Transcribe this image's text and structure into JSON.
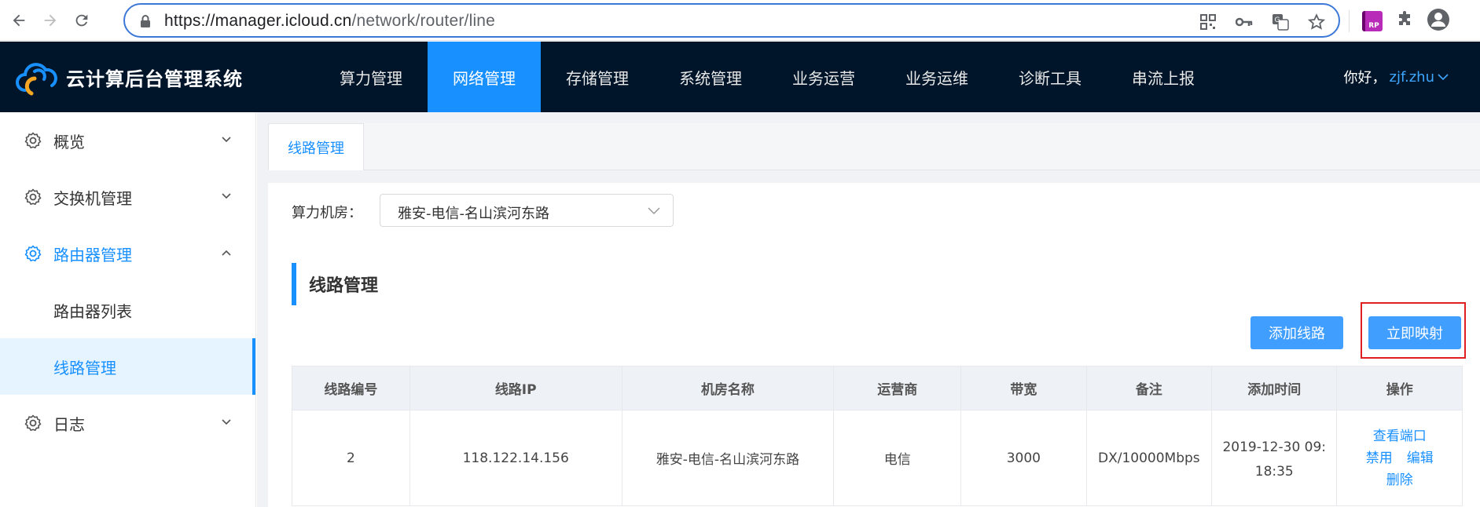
{
  "browser": {
    "url_host": "https://manager.icloud.cn",
    "url_path": "/network/router/line",
    "rp_label": "RP"
  },
  "header": {
    "app_title": "云计算后台管理系统",
    "nav": [
      {
        "label": "算力管理"
      },
      {
        "label": "网络管理"
      },
      {
        "label": "存储管理"
      },
      {
        "label": "系统管理"
      },
      {
        "label": "业务运营"
      },
      {
        "label": "业务运维"
      },
      {
        "label": "诊断工具"
      },
      {
        "label": "串流上报"
      }
    ],
    "active_nav_index": 1,
    "greeting": "你好，",
    "username": "zjf.zhu"
  },
  "sidebar": {
    "items": [
      {
        "label": "概览"
      },
      {
        "label": "交换机管理"
      },
      {
        "label": "路由器管理"
      },
      {
        "label": "路由器列表"
      },
      {
        "label": "线路管理"
      },
      {
        "label": "日志"
      }
    ]
  },
  "content": {
    "tab_label": "线路管理",
    "filter_label": "算力机房：",
    "filter_value": "雅安-电信-名山滨河东路",
    "section_title": "线路管理",
    "add_button": "添加线路",
    "map_button": "立即映射",
    "table": {
      "headers": [
        "线路编号",
        "线路IP",
        "机房名称",
        "运营商",
        "带宽",
        "备注",
        "添加时间",
        "操作"
      ],
      "rows": [
        {
          "id": "2",
          "ip": "118.122.14.156",
          "room": "雅安-电信-名山滨河东路",
          "isp": "电信",
          "bandwidth": "3000",
          "note": "DX/10000Mbps",
          "time_line1": "2019-12-30 09:",
          "time_line2": "18:35",
          "ops": {
            "view_ports": "查看端口",
            "disable": "禁用",
            "edit": "编辑",
            "delete": "删除"
          }
        }
      ]
    }
  },
  "colors": {
    "header_bg": "#001529",
    "accent": "#1890ff",
    "button_bg": "#409eff",
    "highlight_red": "#e02020"
  }
}
